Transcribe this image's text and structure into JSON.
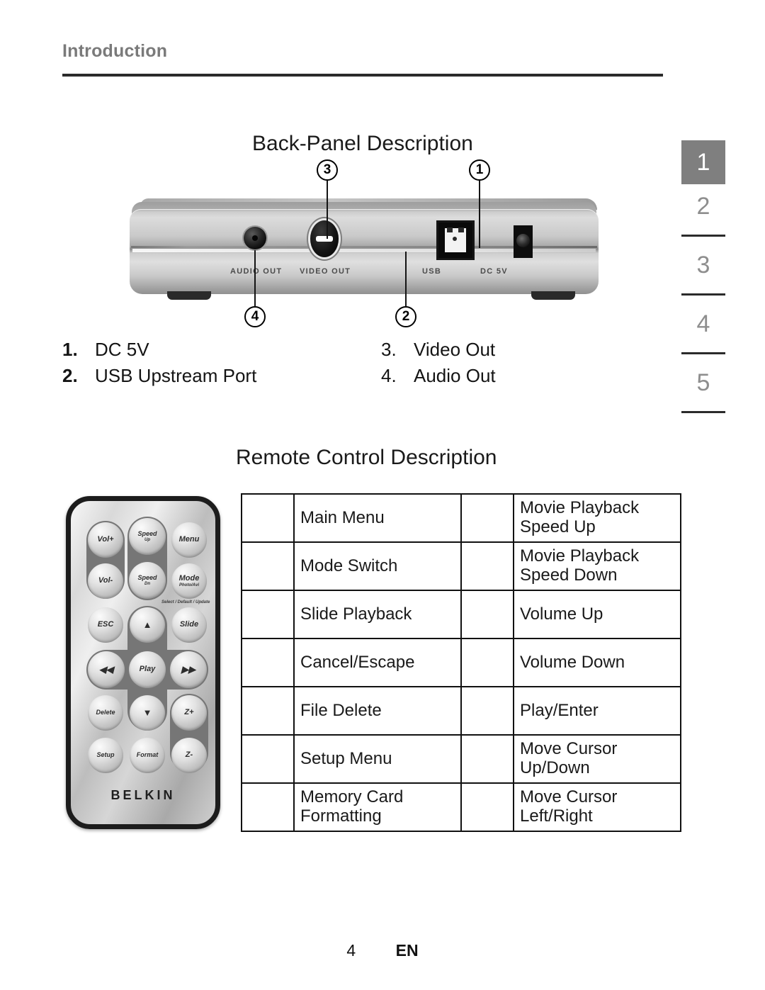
{
  "header": {
    "title": "Introduction"
  },
  "section_tabs": {
    "items": [
      "1",
      "2",
      "3",
      "4",
      "5"
    ],
    "active_index": 0,
    "active_bg": "#7f7f7f",
    "inactive_color": "#8e8e8e"
  },
  "back_panel": {
    "heading": "Back-Panel Description",
    "device_port_labels": {
      "audio_out": "AUDIO OUT",
      "video_out": "VIDEO OUT",
      "usb": "USB",
      "dc": "DC 5V"
    },
    "callouts": [
      {
        "number": "3",
        "position": "top-left"
      },
      {
        "number": "1",
        "position": "top-right"
      },
      {
        "number": "4",
        "position": "bottom-left"
      },
      {
        "number": "2",
        "position": "bottom-right"
      }
    ],
    "list": [
      {
        "num": "1.",
        "label": "DC 5V",
        "bold_num": true
      },
      {
        "num": "3.",
        "label": "Video Out",
        "bold_num": false
      },
      {
        "num": "2.",
        "label": "USB Upstream Port",
        "bold_num": true
      },
      {
        "num": "4.",
        "label": "Audio Out",
        "bold_num": false
      }
    ]
  },
  "remote": {
    "heading": "Remote Control Description",
    "brand": "BELKIN",
    "buttons": [
      {
        "name": "vol-up-button",
        "label": "Vol+"
      },
      {
        "name": "speed-up-button",
        "label": "Speed",
        "sub": "Up"
      },
      {
        "name": "menu-button",
        "label": "Menu"
      },
      {
        "name": "vol-down-button",
        "label": "Vol-"
      },
      {
        "name": "speed-down-button",
        "label": "Speed",
        "sub": "Dn"
      },
      {
        "name": "mode-button",
        "label": "Mode",
        "sub": "Photo/Avi"
      },
      {
        "name": "esc-button",
        "label": "ESC"
      },
      {
        "name": "cursor-up-button",
        "label": "▲"
      },
      {
        "name": "slide-button",
        "label": "Slide"
      },
      {
        "name": "rewind-button",
        "label": "◀◀"
      },
      {
        "name": "play-button",
        "label": "Play"
      },
      {
        "name": "forward-button",
        "label": "▶▶"
      },
      {
        "name": "delete-button",
        "label": "Delete"
      },
      {
        "name": "cursor-down-button",
        "label": "▼"
      },
      {
        "name": "zoom-in-button",
        "label": "Z+"
      },
      {
        "name": "setup-button",
        "label": "Setup"
      },
      {
        "name": "format-button",
        "label": "Format"
      },
      {
        "name": "zoom-out-button",
        "label": "Z-"
      }
    ],
    "mode_note": "Select / Default / Update",
    "table_rows": [
      {
        "left": "Main Menu",
        "right": "Movie Playback\nSpeed Up"
      },
      {
        "left": "Mode Switch",
        "right": "Movie Playback\nSpeed Down"
      },
      {
        "left": "Slide Playback",
        "right": "Volume Up"
      },
      {
        "left": "Cancel/Escape",
        "right": "Volume Down"
      },
      {
        "left": "File Delete",
        "right": "Play/Enter"
      },
      {
        "left": "Setup Menu",
        "right": "Move Cursor\nUp/Down"
      },
      {
        "left": "Memory Card\nFormatting",
        "right": "Move Cursor\nLeft/Right"
      }
    ]
  },
  "footer": {
    "page_number": "4",
    "language": "EN"
  }
}
